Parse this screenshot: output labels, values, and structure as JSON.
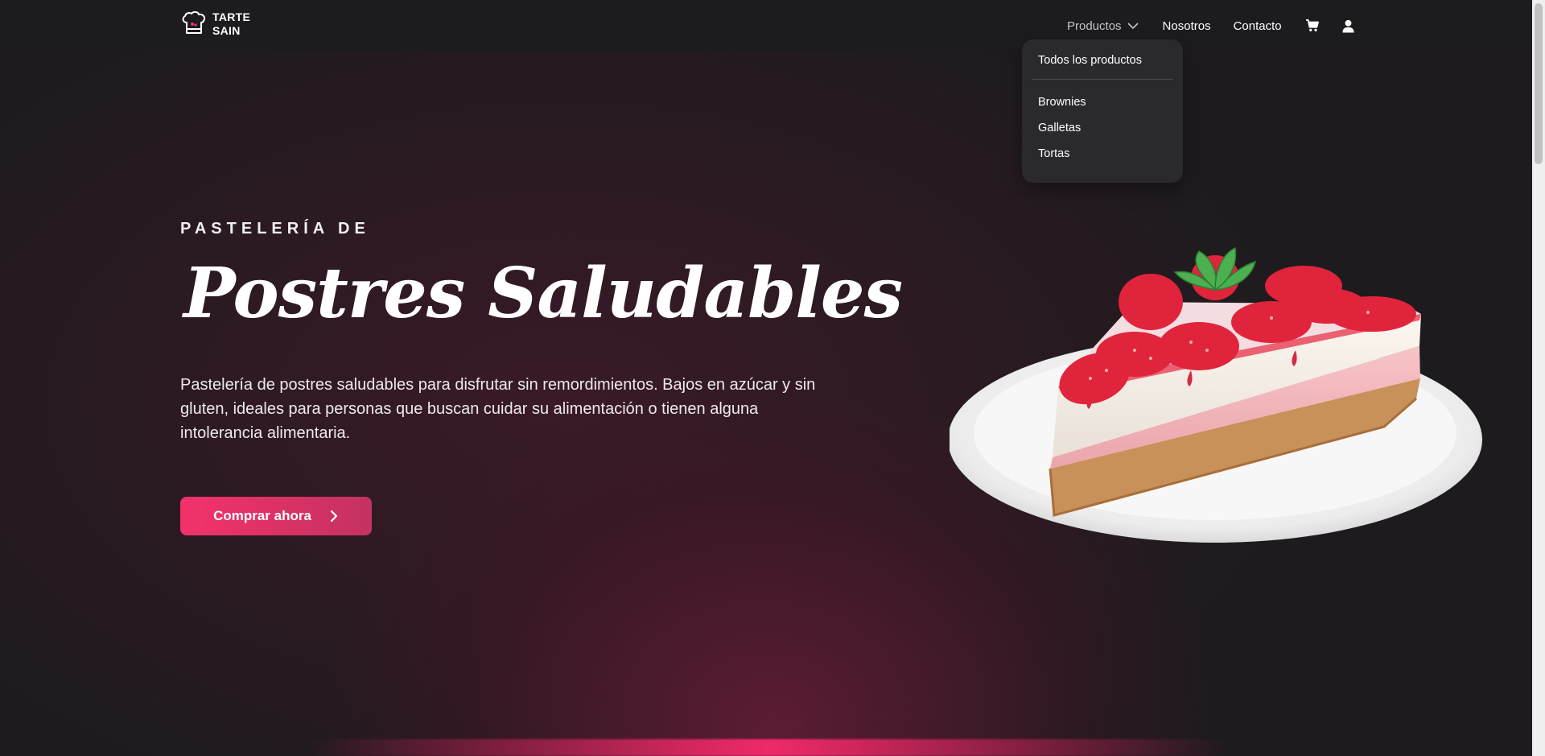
{
  "brand": {
    "line1": "TARTE",
    "line2": "SAIN"
  },
  "nav": {
    "products_label": "Productos",
    "about_label": "Nosotros",
    "contact_label": "Contacto",
    "cart_icon": "cart-icon",
    "user_icon": "user-icon"
  },
  "dropdown": {
    "all_label": "Todos los productos",
    "items": [
      {
        "label": "Brownies"
      },
      {
        "label": "Galletas"
      },
      {
        "label": "Tortas"
      }
    ]
  },
  "hero": {
    "eyebrow": "PASTELERÍA DE",
    "title": "Postres Saludables",
    "description": "Pastelería de postres saludables para disfrutar sin remordimientos. Bajos en azúcar y sin gluten, ideales para personas que buscan cuidar su alimentación o tienen alguna intolerancia alimentaria.",
    "cta_label": "Comprar ahora"
  },
  "colors": {
    "accent": "#f3326b",
    "accent_dark": "#c43261",
    "nav_bg": "#1c1b1d",
    "dropdown_bg": "#2a292b"
  }
}
